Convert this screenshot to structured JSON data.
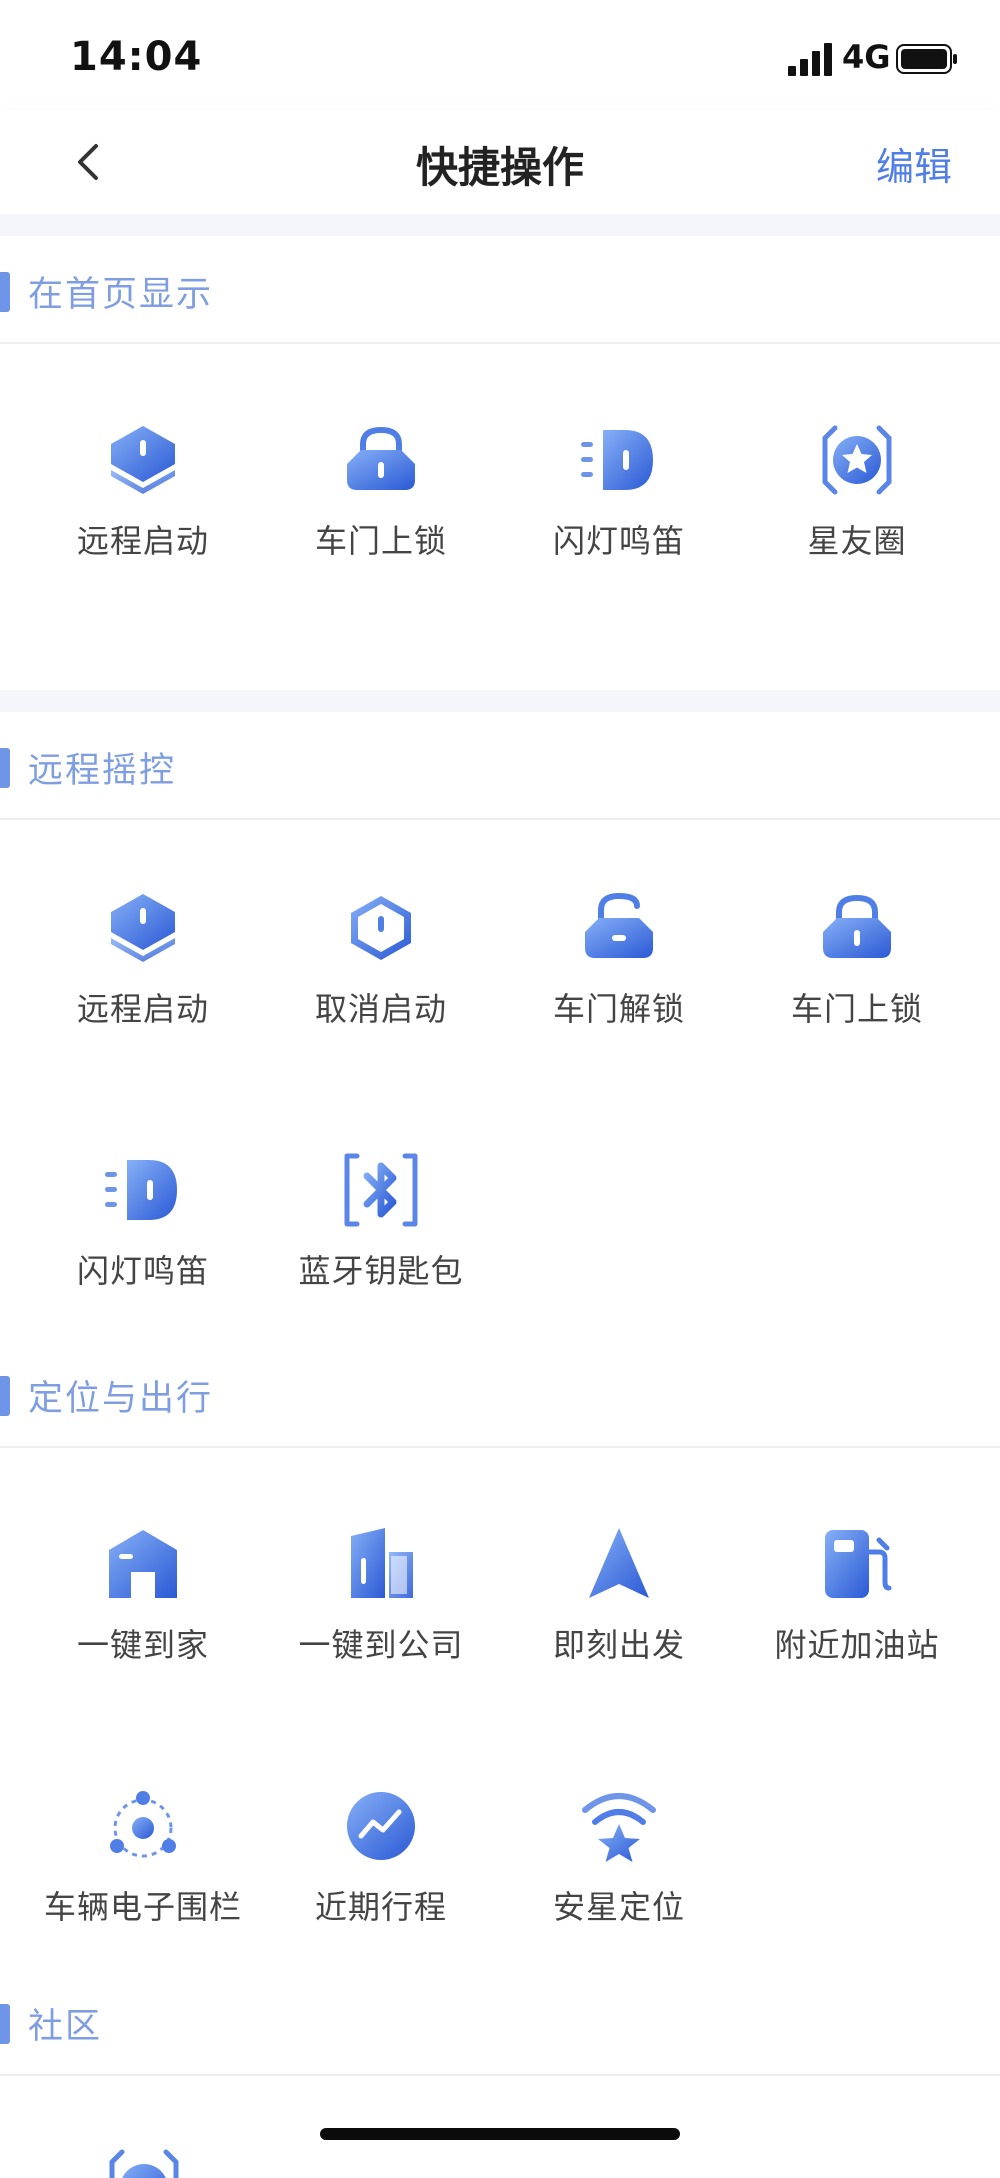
{
  "status": {
    "time": "14:04",
    "network": "4G"
  },
  "nav": {
    "title": "快捷操作",
    "edit": "编辑"
  },
  "colors": {
    "accent": "#4f7ee6",
    "section_title": "#7f9ee2",
    "icon_light": "#7aa8f5",
    "icon_dark": "#3560d8"
  },
  "sections": [
    {
      "title": "在首页显示",
      "items": [
        {
          "label": "远程启动",
          "icon": "remote-start-icon"
        },
        {
          "label": "车门上锁",
          "icon": "lock-icon"
        },
        {
          "label": "闪灯鸣笛",
          "icon": "headlight-icon"
        },
        {
          "label": "星友圈",
          "icon": "star-circle-icon"
        }
      ]
    },
    {
      "title": "远程摇控",
      "items": [
        {
          "label": "远程启动",
          "icon": "remote-start-icon"
        },
        {
          "label": "取消启动",
          "icon": "cancel-start-icon"
        },
        {
          "label": "车门解锁",
          "icon": "unlock-icon"
        },
        {
          "label": "车门上锁",
          "icon": "lock-icon"
        },
        {
          "label": "闪灯鸣笛",
          "icon": "headlight-icon"
        },
        {
          "label": "蓝牙钥匙包",
          "icon": "bluetooth-icon"
        }
      ]
    },
    {
      "title": "定位与出行",
      "items": [
        {
          "label": "一键到家",
          "icon": "home-icon"
        },
        {
          "label": "一键到公司",
          "icon": "office-icon"
        },
        {
          "label": "即刻出发",
          "icon": "navigate-icon"
        },
        {
          "label": "附近加油站",
          "icon": "fuel-station-icon"
        },
        {
          "label": "车辆电子围栏",
          "icon": "geofence-icon"
        },
        {
          "label": "近期行程",
          "icon": "trip-icon"
        },
        {
          "label": "安星定位",
          "icon": "star-signal-icon"
        }
      ]
    },
    {
      "title": "社区",
      "items": []
    }
  ]
}
